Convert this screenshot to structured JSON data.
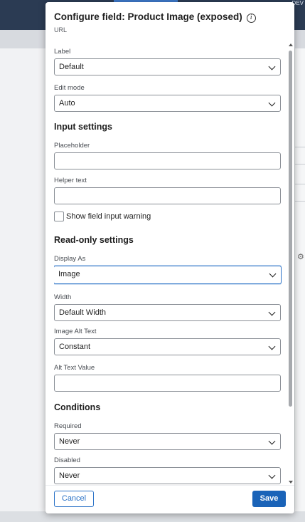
{
  "background": {
    "env_label": "DEV"
  },
  "dialog": {
    "title": "Configure field: Product Image (exposed)",
    "subtitle": "URL",
    "info_icon": "info-icon"
  },
  "fields": {
    "label": {
      "label": "Label",
      "value": "Default"
    },
    "edit_mode": {
      "label": "Edit mode",
      "value": "Auto"
    },
    "input_settings_heading": "Input settings",
    "placeholder": {
      "label": "Placeholder",
      "value": ""
    },
    "helper_text": {
      "label": "Helper text",
      "value": ""
    },
    "show_warning": {
      "label": "Show field input warning",
      "checked": false
    },
    "readonly_heading": "Read-only settings",
    "display_as": {
      "label": "Display As",
      "value": "Image"
    },
    "width": {
      "label": "Width",
      "value": "Default Width"
    },
    "image_alt_text": {
      "label": "Image Alt Text",
      "value": "Constant"
    },
    "alt_text_value": {
      "label": "Alt Text Value",
      "value": ""
    },
    "conditions_heading": "Conditions",
    "required": {
      "label": "Required",
      "value": "Never"
    },
    "disabled": {
      "label": "Disabled",
      "value": "Never"
    }
  },
  "footer": {
    "cancel_label": "Cancel",
    "save_label": "Save"
  },
  "colors": {
    "accent": "#2c73c7",
    "primary_button": "#1a63b8",
    "header_bar": "#2b3b53"
  }
}
